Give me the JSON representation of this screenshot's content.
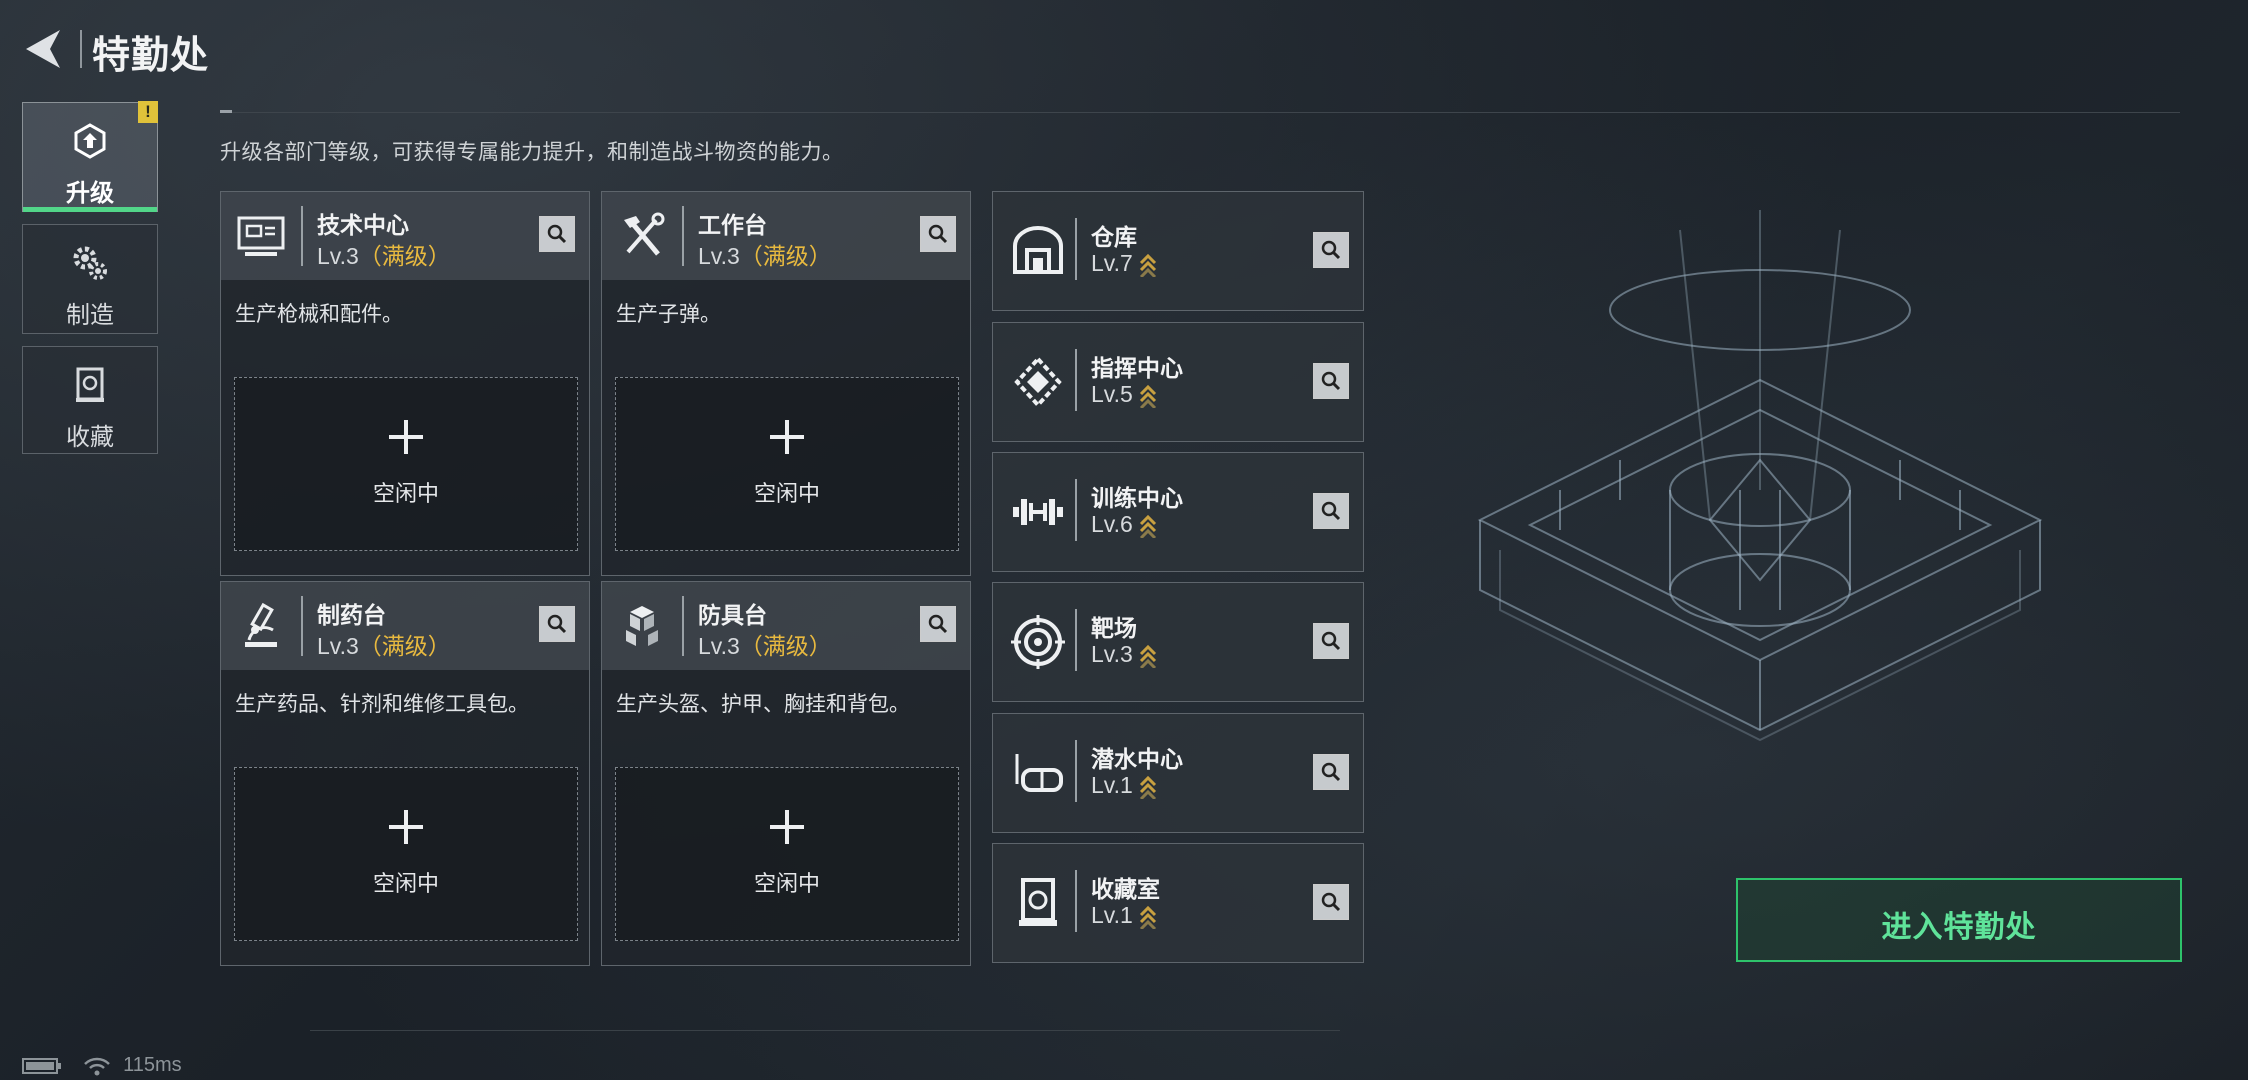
{
  "header": {
    "title": "特勤处"
  },
  "nav": [
    {
      "label": "升级",
      "icon": "upgrade-icon",
      "active": true,
      "badge": "!"
    },
    {
      "label": "制造",
      "icon": "gear-icon",
      "active": false
    },
    {
      "label": "收藏",
      "icon": "collection-icon",
      "active": false
    }
  ],
  "subtitle": "升级各部门等级，可获得专属能力提升，和制造战斗物资的能力。",
  "departments": [
    {
      "name": "技术中心",
      "level": "Lv.3",
      "max": "（满级）",
      "desc": "生产枪械和配件。",
      "slot": "空闲中",
      "icon": "monitor-icon"
    },
    {
      "name": "工作台",
      "level": "Lv.3",
      "max": "（满级）",
      "desc": "生产子弹。",
      "slot": "空闲中",
      "icon": "tools-icon"
    },
    {
      "name": "制药台",
      "level": "Lv.3",
      "max": "（满级）",
      "desc": "生产药品、针剂和维修工具包。",
      "slot": "空闲中",
      "icon": "microscope-icon"
    },
    {
      "name": "防具台",
      "level": "Lv.3",
      "max": "（满级）",
      "desc": "生产头盔、护甲、胸挂和背包。",
      "slot": "空闲中",
      "icon": "armor-blocks-icon"
    }
  ],
  "facilities": [
    {
      "name": "仓库",
      "level": "Lv.7",
      "icon": "warehouse-icon"
    },
    {
      "name": "指挥中心",
      "level": "Lv.5",
      "icon": "command-icon"
    },
    {
      "name": "训练中心",
      "level": "Lv.6",
      "icon": "dumbbell-icon"
    },
    {
      "name": "靶场",
      "level": "Lv.3",
      "icon": "target-icon"
    },
    {
      "name": "潜水中心",
      "level": "Lv.1",
      "icon": "diving-mask-icon"
    },
    {
      "name": "收藏室",
      "level": "Lv.1",
      "icon": "collection-room-icon"
    }
  ],
  "enter_button": "进入特勤处",
  "status": {
    "ping": "115ms"
  },
  "colors": {
    "accent": "#2ec36b",
    "max_level": "#e8b93f",
    "upgrade_arrow": "#c8a040"
  }
}
